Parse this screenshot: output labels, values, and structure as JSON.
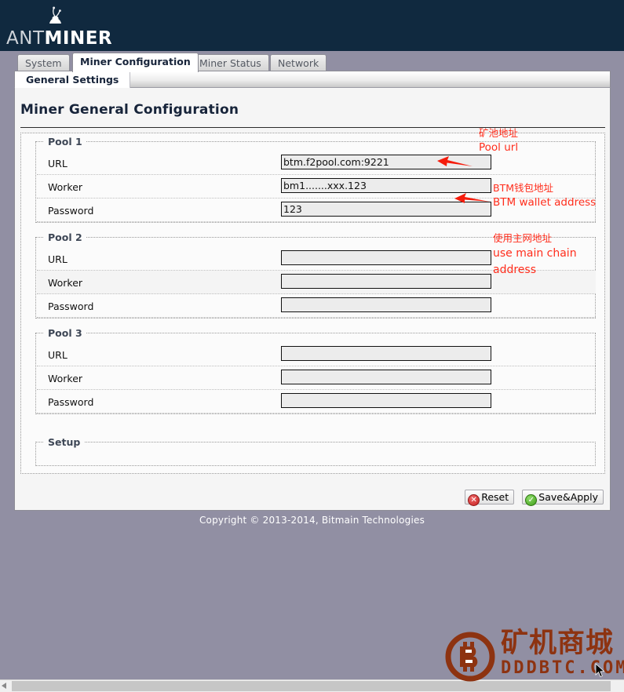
{
  "header": {
    "logo_ant": "ant-icon",
    "logo_thin": "ANT",
    "logo_bold": "MINER"
  },
  "tabs": [
    {
      "label": "System",
      "active": false
    },
    {
      "label": "Miner Configuration",
      "active": true
    },
    {
      "label": "Miner Status",
      "active": false
    },
    {
      "label": "Network",
      "active": false
    }
  ],
  "subtab": {
    "label": "General Settings"
  },
  "page": {
    "title": "Miner General Configuration"
  },
  "pools": [
    {
      "legend": "Pool 1",
      "fields": [
        {
          "label": "URL",
          "value": "btm.f2pool.com:9221"
        },
        {
          "label": "Worker",
          "value": "bm1.......xxx.123"
        },
        {
          "label": "Password",
          "value": "123"
        }
      ]
    },
    {
      "legend": "Pool 2",
      "fields": [
        {
          "label": "URL",
          "value": ""
        },
        {
          "label": "Worker",
          "value": ""
        },
        {
          "label": "Password",
          "value": ""
        }
      ]
    },
    {
      "legend": "Pool 3",
      "fields": [
        {
          "label": "URL",
          "value": ""
        },
        {
          "label": "Worker",
          "value": ""
        },
        {
          "label": "Password",
          "value": ""
        }
      ]
    }
  ],
  "setup": {
    "legend": "Setup"
  },
  "buttons": {
    "reset": "Reset",
    "reset_icon": "cancel-circle-icon",
    "save": "Save&Apply",
    "save_icon": "check-circle-icon"
  },
  "footer": {
    "copyright": "Copyright © 2013-2014, Bitmain Technologies"
  },
  "annotations": [
    {
      "cn": "矿池地址",
      "en": "Pool url"
    },
    {
      "cn": "BTM钱包地址",
      "en": "BTM wallet address"
    },
    {
      "cn": "使用主网地址",
      "en_line1": "use main chain",
      "en_line2": "address"
    }
  ],
  "watermark": {
    "cn": "矿机商城",
    "en": "DDDBTC.COM",
    "logo": "bitcoin-circle-icon",
    "color": "#8d3311"
  },
  "colors": {
    "header_bg": "#10293f",
    "page_bg": "#918fa3",
    "annotation_red": "#ff2d1c",
    "panel_bg": "#f5f5f5"
  }
}
